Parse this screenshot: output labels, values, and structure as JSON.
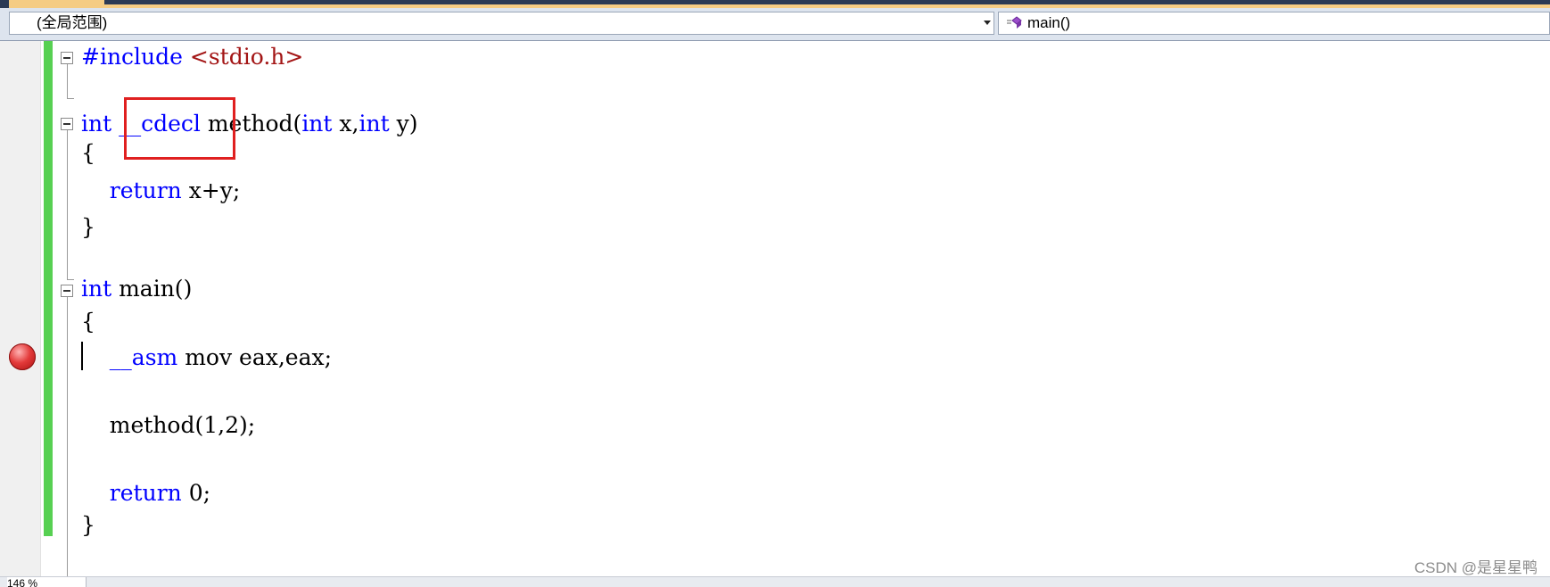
{
  "navigation_bar": {
    "scope_dropdown": "(全局范围)",
    "member_dropdown": "main()"
  },
  "code_lines": [
    {
      "parts": [
        {
          "t": "#include ",
          "c": "kw"
        },
        {
          "t": "<stdio.h>",
          "c": "str"
        }
      ]
    },
    {
      "parts": [
        {
          "t": "int",
          "c": "kw"
        },
        {
          "t": " "
        },
        {
          "t": "__cdecl",
          "c": "kw"
        },
        {
          "t": " method("
        },
        {
          "t": "int",
          "c": "kw"
        },
        {
          "t": " x,"
        },
        {
          "t": "int",
          "c": "kw"
        },
        {
          "t": " y)"
        }
      ]
    },
    {
      "parts": [
        {
          "t": "{"
        }
      ]
    },
    {
      "parts": [
        {
          "t": "    "
        },
        {
          "t": "return",
          "c": "kw"
        },
        {
          "t": " x+y;"
        }
      ]
    },
    {
      "parts": [
        {
          "t": "}"
        }
      ]
    },
    {
      "parts": [
        {
          "t": "int",
          "c": "kw"
        },
        {
          "t": " main()"
        }
      ]
    },
    {
      "parts": [
        {
          "t": "{"
        }
      ]
    },
    {
      "parts": [
        {
          "t": "    "
        },
        {
          "t": "__asm",
          "c": "kw"
        },
        {
          "t": " mov eax,eax;"
        }
      ]
    },
    {
      "parts": [
        {
          "t": "    method(1,2);"
        }
      ]
    },
    {
      "parts": [
        {
          "t": "    "
        },
        {
          "t": "return",
          "c": "kw"
        },
        {
          "t": " 0;"
        }
      ]
    },
    {
      "parts": [
        {
          "t": "}"
        }
      ]
    }
  ],
  "status_bar": {
    "zoom": "146 %"
  },
  "watermark": "CSDN @是星星鸭",
  "colors": {
    "keyword": "#0000ff",
    "include_path": "#a31515",
    "change_bar": "#57d052",
    "breakpoint": "#e33a3a",
    "highlight_box": "#e02020"
  }
}
